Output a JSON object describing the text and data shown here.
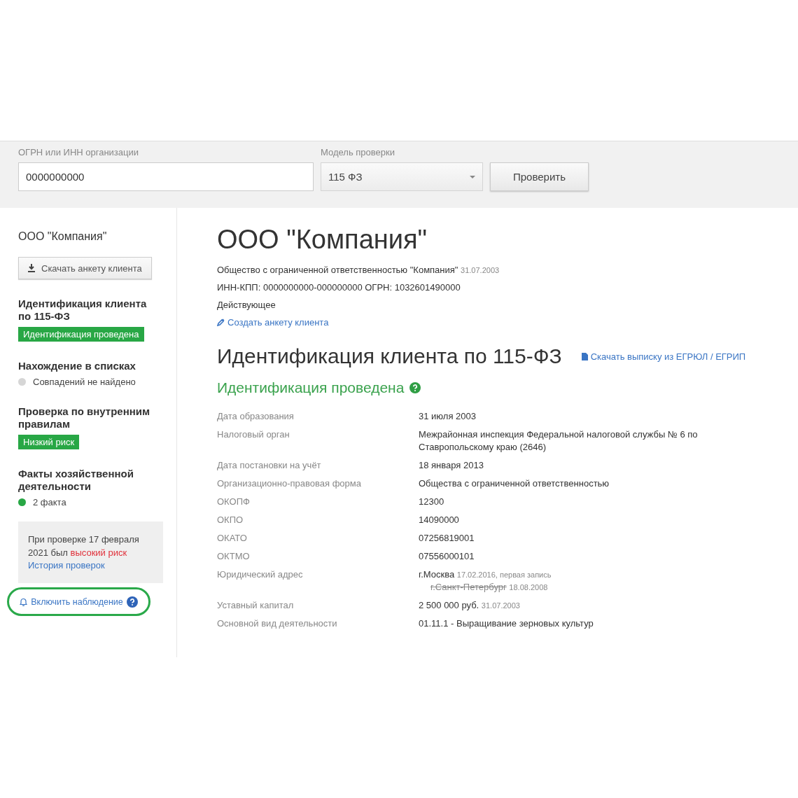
{
  "search": {
    "label": "ОГРН или ИНН организации",
    "value": "0000000000"
  },
  "model": {
    "label": "Модель проверки",
    "value": "115 ФЗ"
  },
  "check_button": "Проверить",
  "sidebar": {
    "company": "ООО \"Компания\"",
    "download_button": "Скачать анкету клиента",
    "sections": [
      {
        "title": "Идентификация клиента по 115-ФЗ",
        "kind": "badge",
        "text": "Идентификация проведена",
        "color": "#28a745"
      },
      {
        "title": "Нахождение в списках",
        "kind": "status",
        "text": "Совпадений не найдено",
        "color": "#d6d6d6"
      },
      {
        "title": "Проверка по внутренним правилам",
        "kind": "badge",
        "text": "Низкий риск",
        "color": "#28a745"
      },
      {
        "title": "Факты хозяйственной деятельности",
        "kind": "status",
        "text": "2 факта",
        "color": "#28a745"
      }
    ],
    "notice": {
      "text": "При проверке 17 февраля 2021 был",
      "risk": "высокий риск",
      "link": "История проверок"
    },
    "watch_button": "Включить наблюдение"
  },
  "main": {
    "title": "ООО \"Компания\"",
    "full_name": "Общество с ограниченной ответственностью \"Компания\"",
    "full_name_date": "31.07.2003",
    "ids": "ИНН-КПП: 0000000000-000000000 ОГРН: 1032601490000",
    "status": "Действующее",
    "create_link": "Создать анкету клиента",
    "section_title": "Идентификация клиента по 115-ФЗ",
    "extract_link": "Скачать выписку из ЕГРЮЛ / ЕГРИП",
    "result": "Идентификация проведена",
    "fields": [
      {
        "label": "Дата образования",
        "value": "31 июля 2003"
      },
      {
        "label": "Налоговый орган",
        "value": "Межрайонная инспекция Федеральной налоговой службы № 6 по Ставропольскому краю (2646)"
      },
      {
        "label": "Дата постановки на учёт",
        "value": "18 января 2013"
      },
      {
        "label": "Организационно-правовая форма",
        "value": "Общества с ограниченной ответственностью"
      },
      {
        "label": "ОКОПФ",
        "value": "12300"
      },
      {
        "label": "ОКПО",
        "value": "14090000"
      },
      {
        "label": "ОКАТО",
        "value": "07256819001"
      },
      {
        "label": "ОКТМО",
        "value": "07556000101"
      },
      {
        "label": "Юридический адрес",
        "value": "г.Москва",
        "note": "17.02.2016, первая запись",
        "history": [
          {
            "value": "г.Санкт-Петербург",
            "note": "18.08.2008"
          }
        ]
      },
      {
        "label": "Уставный капитал",
        "value": "2 500 000 руб.",
        "note": "31.07.2003"
      },
      {
        "label": "Основной вид деятельности",
        "value": "01.11.1 - Выращивание зерновых культур"
      }
    ]
  }
}
